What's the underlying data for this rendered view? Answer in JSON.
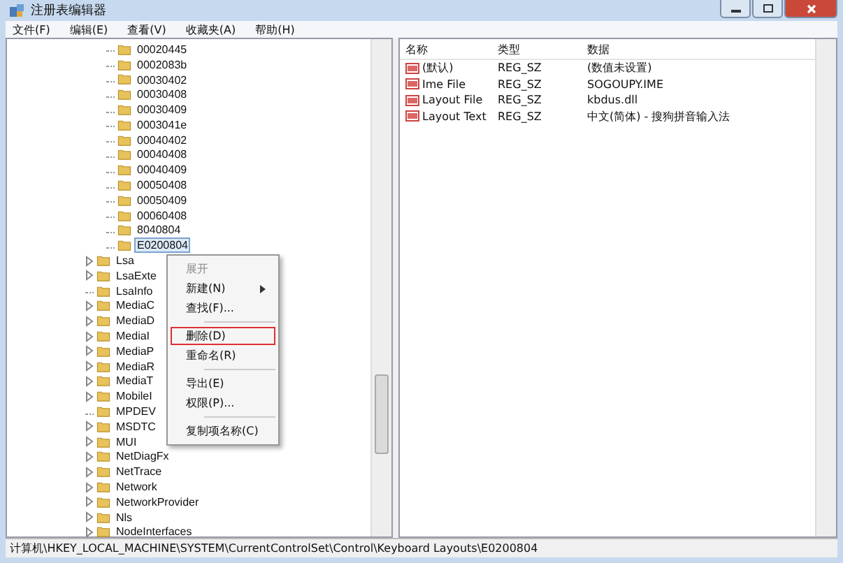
{
  "window": {
    "title": "注册表编辑器"
  },
  "menu_bar": [
    "文件(F)",
    "编辑(E)",
    "查看(V)",
    "收藏夹(A)",
    "帮助(H)"
  ],
  "tree": {
    "scrolled_branch": [
      {
        "label": "00020445",
        "selected": false
      },
      {
        "label": "0002083b",
        "selected": false
      },
      {
        "label": "00030402",
        "selected": false
      },
      {
        "label": "00030408",
        "selected": false
      },
      {
        "label": "00030409",
        "selected": false
      },
      {
        "label": "0003041e",
        "selected": false
      },
      {
        "label": "00040402",
        "selected": false
      },
      {
        "label": "00040408",
        "selected": false
      },
      {
        "label": "00040409",
        "selected": false
      },
      {
        "label": "00050408",
        "selected": false
      },
      {
        "label": "00050409",
        "selected": false
      },
      {
        "label": "00060408",
        "selected": false
      },
      {
        "label": "8040804",
        "selected": false
      },
      {
        "label": "E0200804",
        "selected": true
      }
    ],
    "items": [
      {
        "label": "Lsa",
        "expandable": true
      },
      {
        "label": "LsaExte",
        "expandable": true
      },
      {
        "label": "LsaInfo",
        "expandable": false
      },
      {
        "label": "MediaC",
        "expandable": true
      },
      {
        "label": "MediaD",
        "expandable": true
      },
      {
        "label": "MediaI",
        "expandable": true
      },
      {
        "label": "MediaP",
        "expandable": true
      },
      {
        "label": "MediaR",
        "expandable": true
      },
      {
        "label": "MediaT",
        "expandable": true
      },
      {
        "label": "MobileI",
        "expandable": true
      },
      {
        "label": "MPDEV",
        "expandable": false
      },
      {
        "label": "MSDTC",
        "expandable": true
      },
      {
        "label": "MUI",
        "expandable": true
      },
      {
        "label": "NetDiagFx",
        "expandable": true
      },
      {
        "label": "NetTrace",
        "expandable": true
      },
      {
        "label": "Network",
        "expandable": true
      },
      {
        "label": "NetworkProvider",
        "expandable": true
      },
      {
        "label": "Nls",
        "expandable": true
      },
      {
        "label": "NodeInterfaces",
        "expandable": true
      }
    ]
  },
  "context_menu": [
    {
      "kind": "item",
      "label": "展开",
      "disabled": true,
      "submenu": false,
      "highlighted": false
    },
    {
      "kind": "item",
      "label": "新建(N)",
      "disabled": false,
      "submenu": true,
      "highlighted": false
    },
    {
      "kind": "item",
      "label": "查找(F)...",
      "disabled": false,
      "submenu": false,
      "highlighted": false
    },
    {
      "kind": "separator"
    },
    {
      "kind": "item",
      "label": "删除(D)",
      "disabled": false,
      "submenu": false,
      "highlighted": true
    },
    {
      "kind": "item",
      "label": "重命名(R)",
      "disabled": false,
      "submenu": false,
      "highlighted": false
    },
    {
      "kind": "separator"
    },
    {
      "kind": "item",
      "label": "导出(E)",
      "disabled": false,
      "submenu": false,
      "highlighted": false
    },
    {
      "kind": "item",
      "label": "权限(P)...",
      "disabled": false,
      "submenu": false,
      "highlighted": false
    },
    {
      "kind": "separator"
    },
    {
      "kind": "item",
      "label": "复制项名称(C)",
      "disabled": false,
      "submenu": false,
      "highlighted": false
    }
  ],
  "values": {
    "columns": [
      "名称",
      "类型",
      "数据"
    ],
    "rows": [
      [
        "(默认)",
        "REG_SZ",
        "(数值未设置)"
      ],
      [
        "Ime File",
        "REG_SZ",
        "SOGOUPY.IME"
      ],
      [
        "Layout File",
        "REG_SZ",
        "kbdus.dll"
      ],
      [
        "Layout Text",
        "REG_SZ",
        "中文(简体) - 搜狗拼音输入法"
      ]
    ]
  },
  "status_bar": "计算机\\HKEY_LOCAL_MACHINE\\SYSTEM\\CurrentControlSet\\Control\\Keyboard Layouts\\E0200804"
}
